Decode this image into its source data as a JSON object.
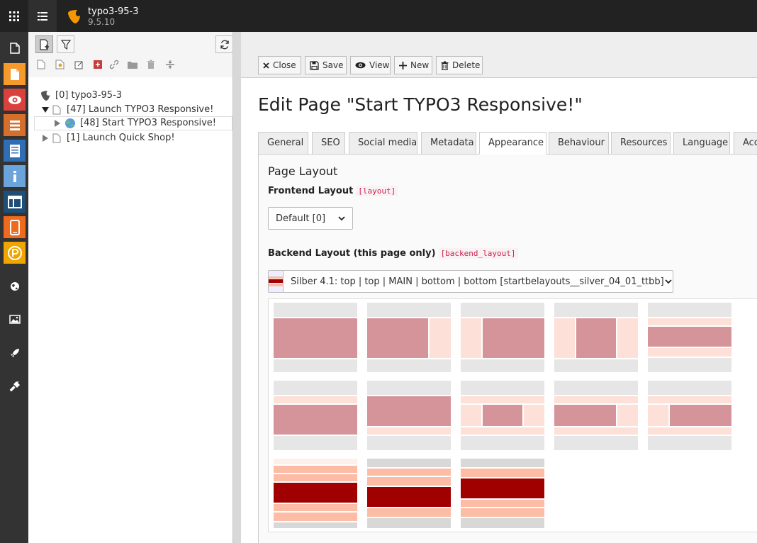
{
  "topbar": {
    "site_name": "typo3-95-3",
    "version": "9.5.10"
  },
  "modules": [
    {
      "icon": "page-module-icon",
      "color": "#333333"
    },
    {
      "icon": "page-icon",
      "color": "#f59a2b"
    },
    {
      "icon": "view-eye-icon",
      "color": "#d9413c"
    },
    {
      "icon": "list-icon",
      "color": "#d66f2c"
    },
    {
      "icon": "form-icon",
      "color": "#2f6db5"
    },
    {
      "icon": "info-icon",
      "color": "#6aa4da"
    },
    {
      "icon": "template-icon",
      "color": "#1f4e79"
    },
    {
      "icon": "responsive-icon",
      "color": "#f06a1d"
    },
    {
      "icon": "powermail-icon",
      "color": "#f0a500"
    },
    {
      "icon": "globe-icon",
      "color": "#333333"
    },
    {
      "icon": "image-icon",
      "color": "#333333"
    },
    {
      "icon": "rocket-icon",
      "color": "#333333"
    },
    {
      "icon": "plug-icon",
      "color": "#333333"
    }
  ],
  "tree": {
    "nodes": [
      {
        "label": "[0] typo3-95-3"
      },
      {
        "label": "[47] Launch TYPO3 Responsive!"
      },
      {
        "label": "[48] Start TYPO3 Responsive!"
      },
      {
        "label": "[1] Launch Quick Shop!"
      }
    ]
  },
  "toolbar": {
    "close": "Close",
    "save": "Save",
    "view": "View",
    "new": "New",
    "delete": "Delete"
  },
  "page_title": "Edit Page \"Start TYPO3 Responsive!\"",
  "tabs": [
    {
      "label": "General"
    },
    {
      "label": "SEO"
    },
    {
      "label": "Social media"
    },
    {
      "label": "Metadata"
    },
    {
      "label": "Appearance"
    },
    {
      "label": "Behaviour"
    },
    {
      "label": "Resources"
    },
    {
      "label": "Language"
    },
    {
      "label": "Acc"
    }
  ],
  "panel": {
    "section_title": "Page Layout",
    "frontend_label": "Frontend Layout",
    "frontend_code": "[layout]",
    "frontend_value": "Default [0]",
    "backend_label": "Backend Layout (this page only)",
    "backend_code": "[backend_layout]",
    "backend_value": "Silber 4.1: top | top | MAIN | bottom | bottom [startbelayouts__silver_04_01_ttbb]"
  },
  "colors": {
    "accent_orange": "#f49700",
    "layout_pink": "#d4949a",
    "layout_light": "#fde0d8",
    "layout_dark_red": "#a10000",
    "layout_salmon": "#fdbca5"
  }
}
